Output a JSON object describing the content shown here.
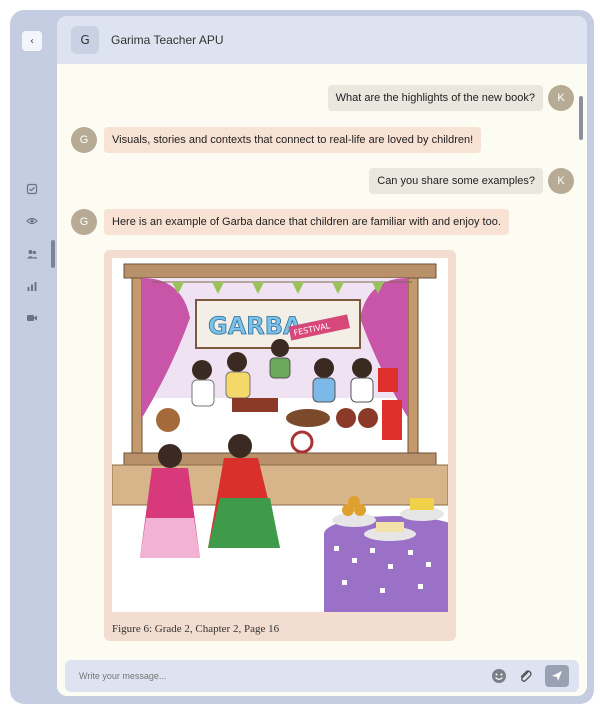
{
  "header": {
    "avatar_initial": "G",
    "title": "Garima Teacher APU"
  },
  "sidebar": {
    "back_glyph": "‹",
    "icons": [
      "checklist-icon",
      "eye-icon",
      "users-icon",
      "bar-chart-icon",
      "video-icon"
    ]
  },
  "messages": [
    {
      "from": "user",
      "avatar": "K",
      "text": "What are the highlights of the new book?"
    },
    {
      "from": "bot",
      "avatar": "G",
      "text": "Visuals, stories and contexts that connect to real-life are loved by children!"
    },
    {
      "from": "user",
      "avatar": "K",
      "text": "Can you share some examples?"
    },
    {
      "from": "bot",
      "avatar": "G",
      "text": "Here is an example of Garba dance that children are familiar with and enjoy too."
    }
  ],
  "image_card": {
    "banner_title": "GARBA",
    "banner_subtitle": "FESTIVAL",
    "caption": "Figure 6: Grade 2, Chapter 2, Page 16"
  },
  "composer": {
    "placeholder": "Write your message..."
  },
  "colors": {
    "frame": "#c5cde3",
    "header": "#dde3f0",
    "chat_bg": "#fdfcf3",
    "bot_bubble": "#f7e2d4",
    "user_bubble": "#eae7df",
    "avatar": "#b7ab96"
  }
}
